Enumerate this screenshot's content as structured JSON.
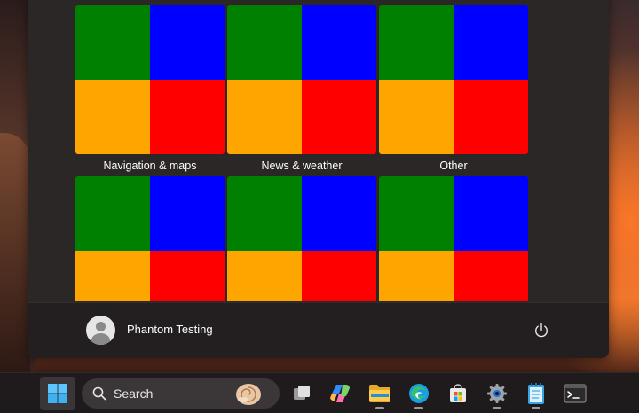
{
  "start_menu": {
    "tiles": [
      {
        "label": "Navigation & maps"
      },
      {
        "label": "News & weather"
      },
      {
        "label": "Other"
      },
      {
        "label": ""
      },
      {
        "label": ""
      },
      {
        "label": ""
      }
    ],
    "tile_colors": [
      "#008000",
      "#0000ff",
      "#ffa500",
      "#ff0000"
    ],
    "user": {
      "name": "Phantom Testing",
      "avatar_icon": "user-avatar-icon"
    },
    "power_icon": "power-icon"
  },
  "taskbar": {
    "search_label": "Search",
    "items": [
      {
        "name": "start-button",
        "icon": "windows-logo-icon",
        "active": true
      },
      {
        "name": "task-view-button",
        "icon": "task-view-icon"
      },
      {
        "name": "copilot-button",
        "icon": "copilot-icon"
      },
      {
        "name": "file-explorer-button",
        "icon": "folder-icon",
        "running": true
      },
      {
        "name": "edge-button",
        "icon": "edge-icon",
        "running": true
      },
      {
        "name": "store-button",
        "icon": "store-icon"
      },
      {
        "name": "settings-button",
        "icon": "gear-icon",
        "running": true
      },
      {
        "name": "notepad-button",
        "icon": "notepad-icon",
        "running": true
      },
      {
        "name": "terminal-button",
        "icon": "terminal-icon"
      }
    ]
  }
}
